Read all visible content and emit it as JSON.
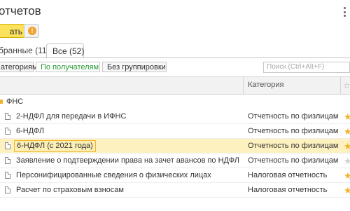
{
  "header": {
    "title": "отчетов"
  },
  "toolbar": {
    "create_label": "ать"
  },
  "tabs": [
    {
      "label": "бранные (11)"
    },
    {
      "label": "Все (52)"
    }
  ],
  "grouping": {
    "by_category": "атегориям",
    "by_recipient": "По получателям",
    "no_grouping": "Без группировки"
  },
  "search": {
    "placeholder": "Поиск (Ctrl+Alt+F)"
  },
  "table": {
    "column_category": "Категория",
    "group_label": "ФНС",
    "rows": [
      {
        "name": "2-НДФЛ для передачи в ИФНС",
        "category": "Отчетность по физлицам",
        "favorite": true,
        "selected": false
      },
      {
        "name": "6-НДФЛ",
        "category": "Отчетность по физлицам",
        "favorite": true,
        "selected": false
      },
      {
        "name": "6-НДФЛ (с 2021 года)",
        "category": "Отчетность по физлицам",
        "favorite": true,
        "selected": true
      },
      {
        "name": "Заявление о подтверждении права на зачет авансов по НДФЛ",
        "category": "Отчетность по физлицам",
        "favorite": false,
        "selected": false
      },
      {
        "name": "Персонифицированные сведения о физических лицах",
        "category": "Налоговая отчетность",
        "favorite": true,
        "selected": false
      },
      {
        "name": "Расчет по страховым взносам",
        "category": "Налоговая отчетность",
        "favorite": true,
        "selected": false
      }
    ]
  },
  "colors": {
    "accent_yellow": "#fbe15c",
    "star": "#f0b429",
    "green_text": "#2a9a34",
    "selected_row": "#fdf1c0"
  }
}
